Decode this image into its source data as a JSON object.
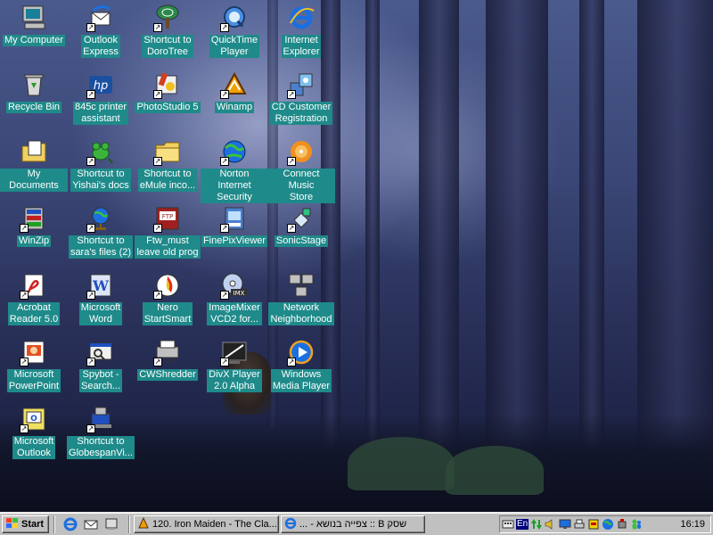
{
  "desktop": {
    "icons": [
      {
        "label": "My Computer",
        "icon": "my-computer-icon",
        "shortcut": false
      },
      {
        "label": "Outlook\nExpress",
        "icon": "outlook-express-icon",
        "shortcut": true
      },
      {
        "label": "Shortcut to\nDoroTree",
        "icon": "dorotree-icon",
        "shortcut": true
      },
      {
        "label": "QuickTime\nPlayer",
        "icon": "quicktime-icon",
        "shortcut": true
      },
      {
        "label": "Internet\nExplorer",
        "icon": "internet-explorer-icon",
        "shortcut": false
      },
      {
        "label": "Recycle Bin",
        "icon": "recycle-bin-icon",
        "shortcut": false
      },
      {
        "label": "845c printer\nassistant",
        "icon": "hp-printer-icon",
        "shortcut": true
      },
      {
        "label": "PhotoStudio 5",
        "icon": "photostudio-icon",
        "shortcut": true
      },
      {
        "label": "Winamp",
        "icon": "winamp-icon",
        "shortcut": true
      },
      {
        "label": "CD Customer\nRegistration",
        "icon": "cd-registration-icon",
        "shortcut": true
      },
      {
        "label": "My Documents",
        "icon": "my-documents-icon",
        "shortcut": false
      },
      {
        "label": "Shortcut to\nYishai's docs",
        "icon": "frog-icon",
        "shortcut": true
      },
      {
        "label": "Shortcut to\neMule inco...",
        "icon": "folder-icon",
        "shortcut": true
      },
      {
        "label": "Norton Internet\nSecurity",
        "icon": "norton-globe-icon",
        "shortcut": true
      },
      {
        "label": "Connect Music\nStore",
        "icon": "connect-music-icon",
        "shortcut": true
      },
      {
        "label": "WinZip",
        "icon": "winzip-icon",
        "shortcut": true
      },
      {
        "label": "Shortcut to\nsara's files (2)",
        "icon": "globe-stand-icon",
        "shortcut": true
      },
      {
        "label": "Ftw_must\nleave old prog",
        "icon": "ftp-icon",
        "shortcut": true
      },
      {
        "label": "FinePixViewer",
        "icon": "finepix-icon",
        "shortcut": true
      },
      {
        "label": "SonicStage",
        "icon": "sonicstage-icon",
        "shortcut": true
      },
      {
        "label": "Acrobat\nReader 5.0",
        "icon": "acrobat-icon",
        "shortcut": true
      },
      {
        "label": "Microsoft\nWord",
        "icon": "word-icon",
        "shortcut": true
      },
      {
        "label": "Nero\nStartSmart",
        "icon": "nero-icon",
        "shortcut": true
      },
      {
        "label": "ImageMixer\nVCD2 for...",
        "icon": "imagemixer-icon",
        "shortcut": true
      },
      {
        "label": "Network\nNeighborhood",
        "icon": "network-icon",
        "shortcut": false
      },
      {
        "label": "Microsoft\nPowerPoint",
        "icon": "powerpoint-icon",
        "shortcut": true
      },
      {
        "label": "Spybot -\nSearch...",
        "icon": "spybot-icon",
        "shortcut": true
      },
      {
        "label": "CWShredder",
        "icon": "cwshredder-icon",
        "shortcut": true
      },
      {
        "label": "DivX Player\n2.0 Alpha",
        "icon": "divx-icon",
        "shortcut": true
      },
      {
        "label": "Windows\nMedia Player",
        "icon": "media-player-icon",
        "shortcut": true
      },
      {
        "label": "Microsoft\nOutlook",
        "icon": "outlook-icon",
        "shortcut": true
      },
      {
        "label": "Shortcut to\nGlobespanVi...",
        "icon": "globespan-icon",
        "shortcut": true
      }
    ]
  },
  "taskbar": {
    "start_label": "Start",
    "quick_launch": [
      "internet-explorer-icon",
      "outlook-express-icon",
      "show-desktop-icon"
    ],
    "tasks": [
      {
        "label": "120. Iron Maiden - The Cla...",
        "icon": "winamp-icon"
      },
      {
        "label": "שסק B :: צפייה בנושא - ...",
        "icon": "internet-explorer-icon"
      }
    ],
    "tray": {
      "language": "En",
      "icons": [
        "keyboard-icon",
        "network-arrows-icon",
        "speaker-icon",
        "monitor-icon",
        "printer-icon",
        "antivirus-icon",
        "globe-icon",
        "usb-icon",
        "messenger-icon"
      ],
      "clock": "16:19"
    }
  }
}
